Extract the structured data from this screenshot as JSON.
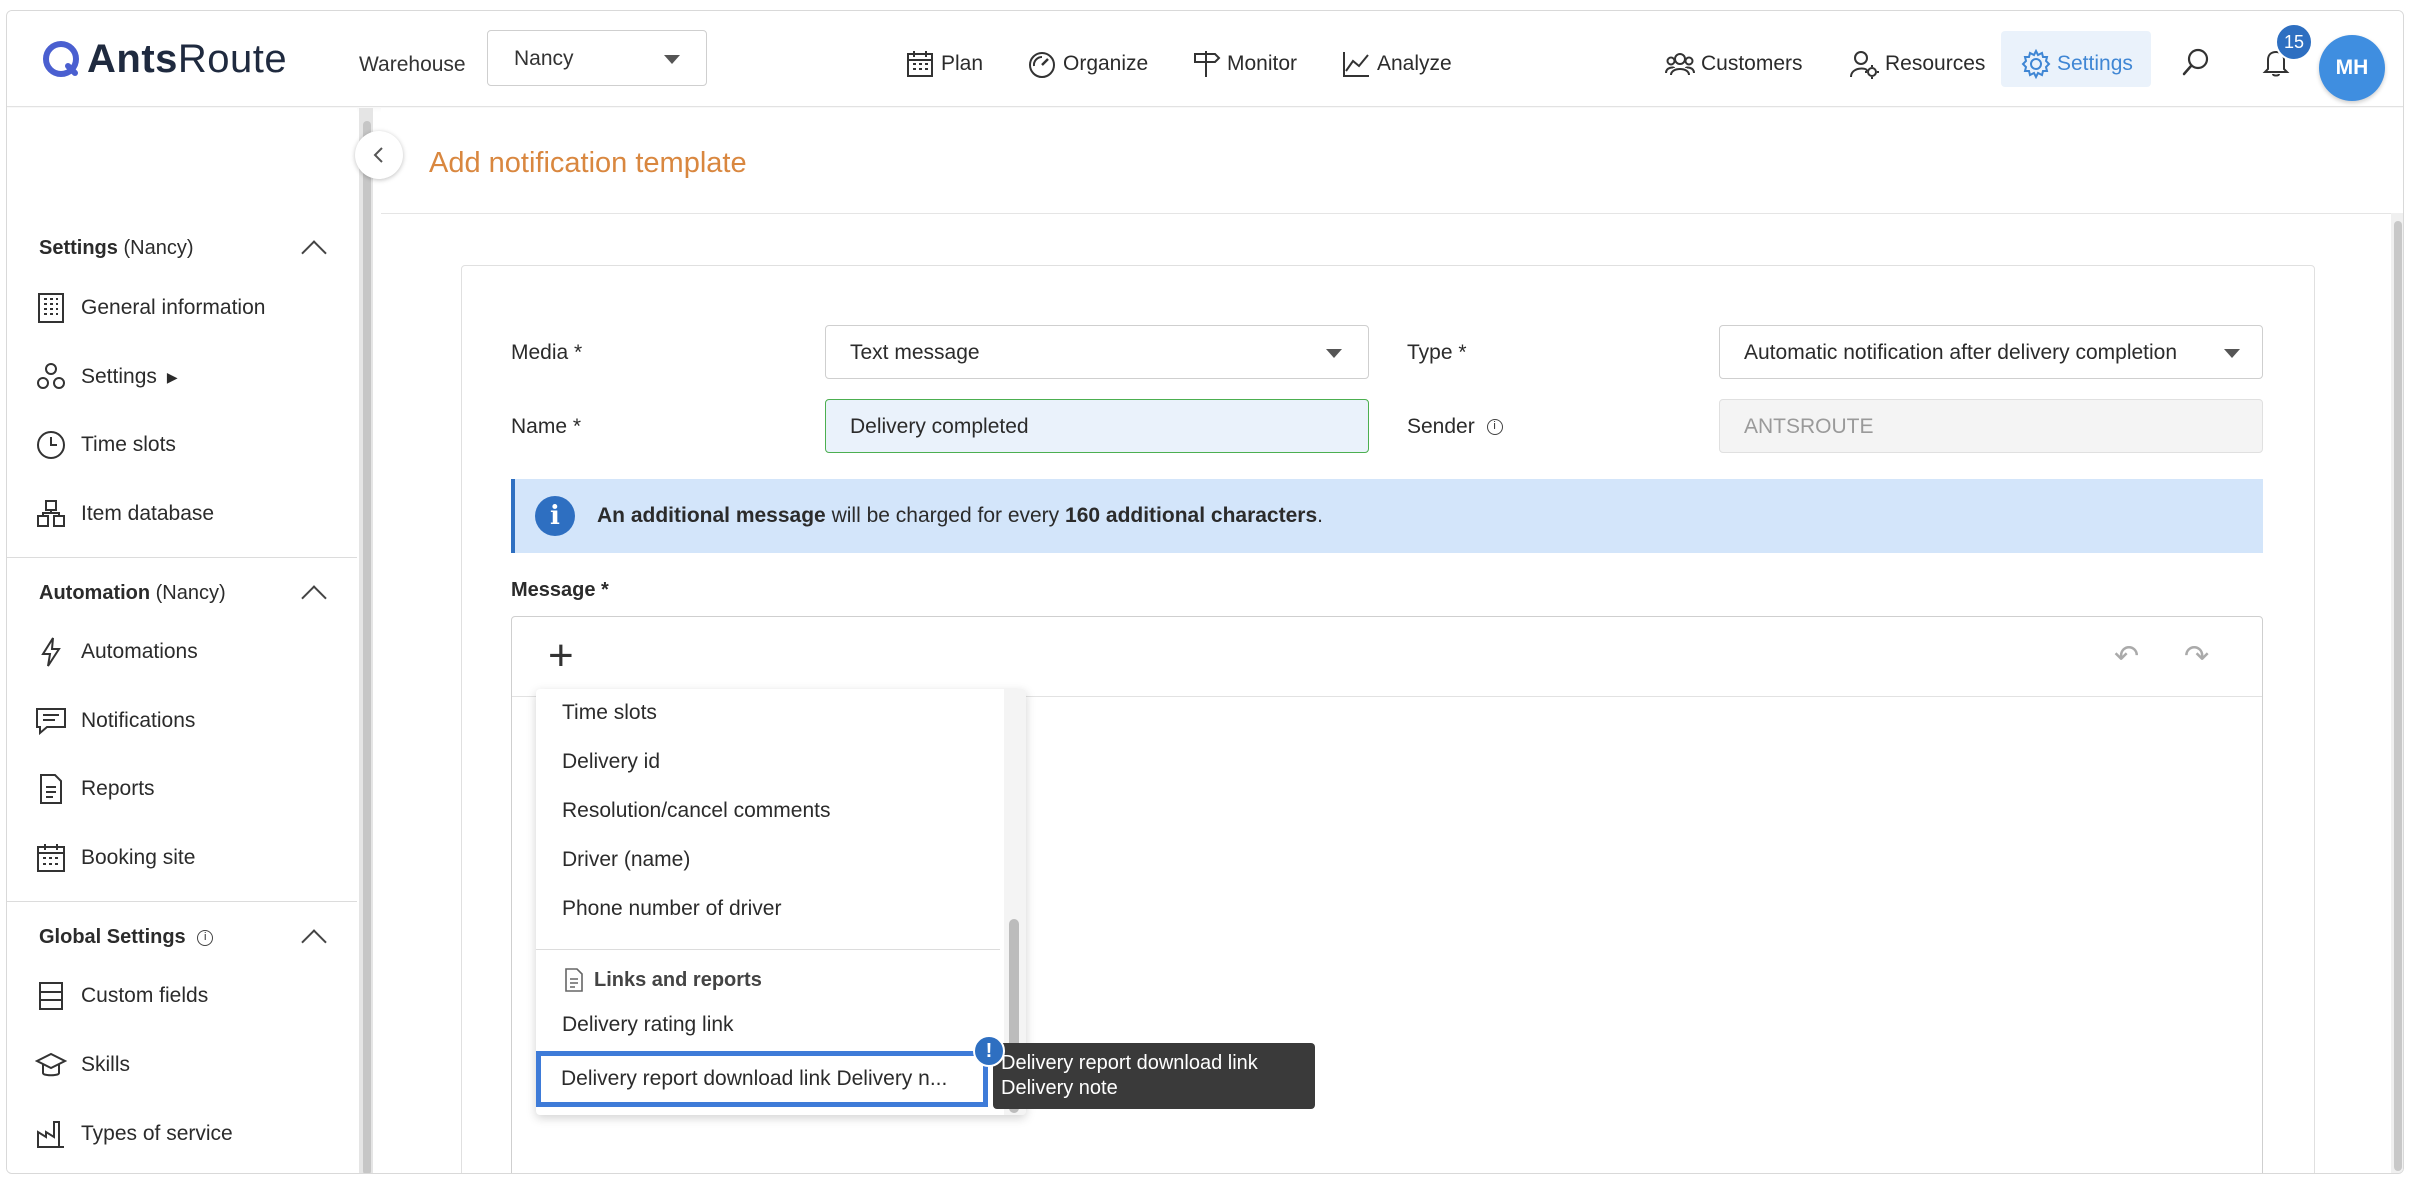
{
  "header": {
    "logo_bold": "Ants",
    "logo_light": "Route",
    "warehouse_label": "Warehouse",
    "warehouse_value": "Nancy",
    "nav": [
      {
        "label": "Plan",
        "icon": "calendar-icon"
      },
      {
        "label": "Organize",
        "icon": "gauge-icon"
      },
      {
        "label": "Monitor",
        "icon": "signpost-icon"
      },
      {
        "label": "Analyze",
        "icon": "chart-icon"
      }
    ],
    "right_nav": [
      {
        "label": "Customers",
        "icon": "customers-icon"
      },
      {
        "label": "Resources",
        "icon": "resources-icon"
      },
      {
        "label": "Settings",
        "icon": "gear-icon",
        "active": true
      }
    ],
    "notification_count": "15",
    "avatar_initials": "MH",
    "accent_color": "#3f86d4"
  },
  "sidebar": {
    "sections": [
      {
        "title_bold": "Settings",
        "title_suffix": " (Nancy)",
        "items": [
          {
            "label": "General information",
            "icon": "building-icon"
          },
          {
            "label": "Settings",
            "icon": "cubes-icon",
            "arrow": "▶"
          },
          {
            "label": "Time slots",
            "icon": "clock-icon"
          },
          {
            "label": "Item database",
            "icon": "boxes-icon"
          }
        ]
      },
      {
        "title_bold": "Automation",
        "title_suffix": " (Nancy)",
        "items": [
          {
            "label": "Automations",
            "icon": "lightning-icon"
          },
          {
            "label": "Notifications",
            "icon": "chat-icon"
          },
          {
            "label": "Reports",
            "icon": "document-icon"
          },
          {
            "label": "Booking site",
            "icon": "calendar-icon"
          }
        ]
      },
      {
        "title_bold": "Global Settings",
        "title_suffix": "",
        "items": [
          {
            "label": "Custom fields",
            "icon": "list-icon"
          },
          {
            "label": "Skills",
            "icon": "graduation-icon"
          },
          {
            "label": "Types of service",
            "icon": "factory-icon"
          }
        ]
      }
    ]
  },
  "page": {
    "title": "Add notification template",
    "title_color": "#d9873f",
    "form": {
      "media_label": "Media *",
      "media_value": "Text message",
      "type_label": "Type *",
      "type_value": "Automatic notification after delivery completion",
      "name_label": "Name *",
      "name_value": "Delivery completed",
      "sender_label": "Sender",
      "sender_value": "ANTSROUTE"
    },
    "banner": {
      "icon": "i",
      "bold1": "An additional message",
      "text1": " will be charged for every ",
      "bold2": "160 additional characters",
      "text2": "."
    },
    "message_label": "Message *",
    "editor": {
      "add_icon": "+",
      "undo_icon": "↶",
      "redo_icon": "↷"
    }
  },
  "dropdown": {
    "items": [
      "Time slots",
      "Delivery id",
      "Resolution/cancel comments",
      "Driver (name)",
      "Phone number of driver"
    ],
    "group_label": "Links and reports",
    "group_items": [
      "Delivery rating link"
    ],
    "highlighted_item": "Delivery report download link Delivery n...",
    "warning_icon": "!",
    "tooltip_line1": "Delivery report download link",
    "tooltip_line2": "Delivery note"
  }
}
